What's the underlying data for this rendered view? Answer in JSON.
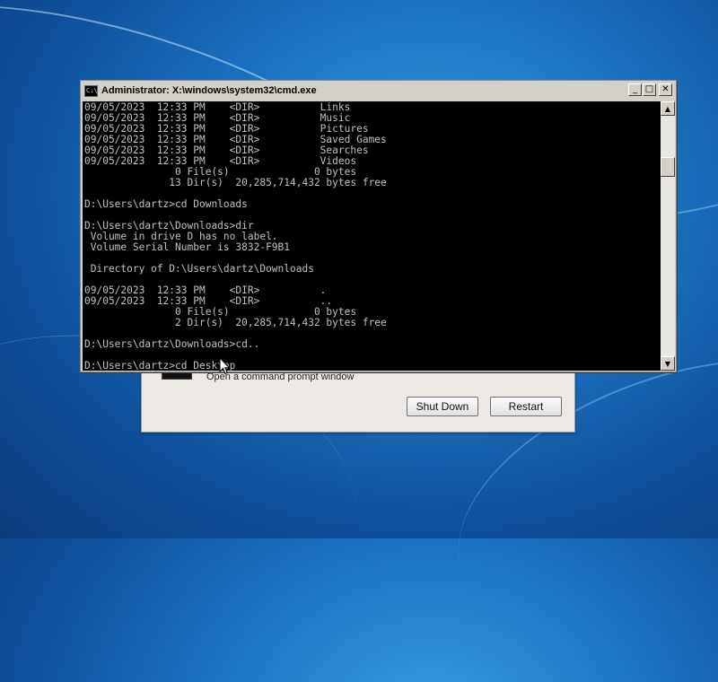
{
  "recovery_dialog": {
    "description": "Open a command prompt window",
    "shutdown_label": "Shut Down",
    "restart_label": "Restart"
  },
  "cmd_window": {
    "title": "Administrator: X:\\windows\\system32\\cmd.exe",
    "icon_text": "C:\\",
    "minimize_glyph": "_",
    "maximize_glyph": "□",
    "close_glyph": "✕",
    "console_output": "09/05/2023  12:33 PM    <DIR>          Links\n09/05/2023  12:33 PM    <DIR>          Music\n09/05/2023  12:33 PM    <DIR>          Pictures\n09/05/2023  12:33 PM    <DIR>          Saved Games\n09/05/2023  12:33 PM    <DIR>          Searches\n09/05/2023  12:33 PM    <DIR>          Videos\n               0 File(s)              0 bytes\n              13 Dir(s)  20,285,714,432 bytes free\n\nD:\\Users\\dartz>cd Downloads\n\nD:\\Users\\dartz\\Downloads>dir\n Volume in drive D has no label.\n Volume Serial Number is 3832-F9B1\n\n Directory of D:\\Users\\dartz\\Downloads\n\n09/05/2023  12:33 PM    <DIR>          .\n09/05/2023  12:33 PM    <DIR>          ..\n               0 File(s)              0 bytes\n               2 Dir(s)  20,285,714,432 bytes free\n\nD:\\Users\\dartz\\Downloads>cd..\n\nD:\\Users\\dartz>cd Desktop",
    "cursor": "_",
    "scroll_up_glyph": "▲",
    "scroll_down_glyph": "▼"
  }
}
